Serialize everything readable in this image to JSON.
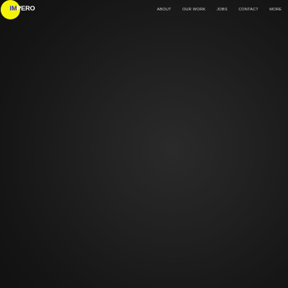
{
  "brand": {
    "logo_highlight": "IM",
    "logo_rest": "PERO",
    "accent_color": "#f4f40a",
    "highlight_color": "#2b2bd8"
  },
  "nav": {
    "items": [
      {
        "label": "ABOUT"
      },
      {
        "label": "OUR WORK"
      },
      {
        "label": "JOBS"
      },
      {
        "label": "CONTACT"
      },
      {
        "label": "MORE"
      }
    ]
  }
}
